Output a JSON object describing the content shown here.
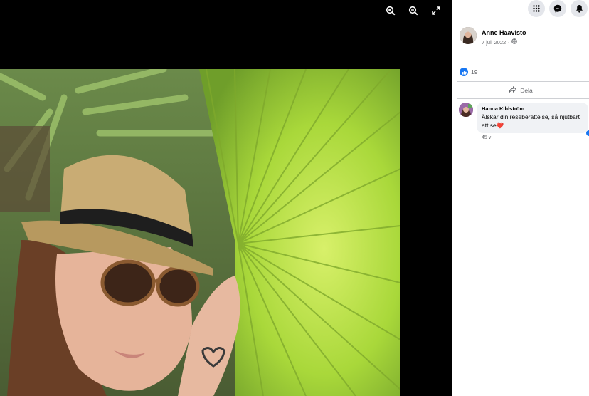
{
  "viewer": {
    "tools": [
      "zoom-in-icon",
      "zoom-out-icon",
      "fullscreen-icon"
    ]
  },
  "panel": {
    "top_icons": [
      "menu-grid-icon",
      "messenger-icon",
      "notifications-icon"
    ],
    "post": {
      "author": "Anne Haavisto",
      "date": "7 juli 2022 ·",
      "audience_icon": "globe-icon"
    },
    "reactions": {
      "count": "19",
      "icon": "like-icon"
    },
    "share_label": "Dela",
    "comment": {
      "author": "Hanna Kihlström",
      "text": "Älskar din reseberättelse, så njutbart att se",
      "emoji": "❤️",
      "time": "45 v"
    }
  },
  "colors": {
    "accent": "#1877f2",
    "panel_bg": "#ffffff",
    "bubble_bg": "#f0f2f5",
    "muted_text": "#65676b"
  }
}
